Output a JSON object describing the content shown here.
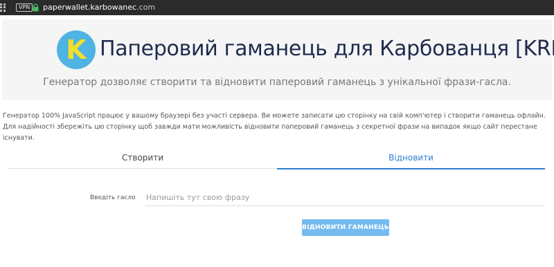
{
  "browser": {
    "vpn_badge": "VPN",
    "url_host": "paperwallet.karbowanec",
    "url_tld": ".com",
    "icons": [
      "apps-grid-icon",
      "lock-icon"
    ],
    "lock_color": "#3fbf5f"
  },
  "hero": {
    "logo_letter": "K",
    "title": "Паперовий гаманець для Карбованця [KRB]",
    "subtitle": "Генератор дозволяє створити та відновити паперовий гаманець з унікальної фрази-гасла.",
    "logo_bg_color": "#4fb3e3",
    "logo_letter_color": "#f4df2c"
  },
  "info": {
    "text": "Генератор 100% JavaScript працює у вашому браузері без участі сервера. Ви можете записати цю сторінку на свій комп'ютер і створити гаманець офлайн. Для надійності збережіть цю сторінку щоб завжди мати можливість відновити паперовий гаманець з секретної фрази на випадок якщо сайт перестане існувати."
  },
  "tabs": {
    "create": "Створити",
    "restore": "Відновити",
    "active": "restore",
    "accent_color": "#2e7fd0"
  },
  "form": {
    "label": "Введіть гасло",
    "placeholder": "Напишіть тут свою фразу",
    "value": "",
    "button_label": "ВІДНОВИТИ ГАМАНЕЦЬ",
    "button_color": "#75bbf0"
  }
}
